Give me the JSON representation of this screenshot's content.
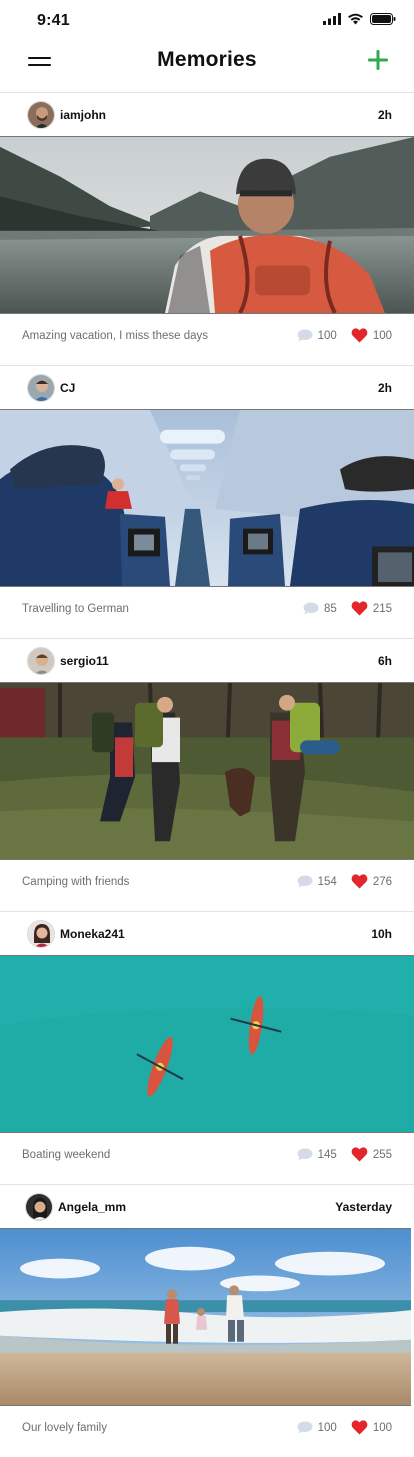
{
  "status_bar": {
    "time": "9:41",
    "icons": [
      "signal-icon",
      "wifi-icon",
      "battery-icon"
    ]
  },
  "header": {
    "title": "Memories",
    "menu_icon": "hamburger-icon",
    "add_icon": "plus-icon",
    "accent_color": "#2eaa4e"
  },
  "posts": [
    {
      "username": "iamjohn",
      "time": "2h",
      "caption": "Amazing vacation, I miss these days",
      "comments": "100",
      "likes": "100"
    },
    {
      "username": "CJ",
      "time": "2h",
      "caption": "Travelling to German",
      "comments": "85",
      "likes": "215"
    },
    {
      "username": "sergio11",
      "time": "6h",
      "caption": "Camping with friends",
      "comments": "154",
      "likes": "276"
    },
    {
      "username": "Moneka241",
      "time": "10h",
      "caption": "Boating weekend",
      "comments": "145",
      "likes": "255"
    },
    {
      "username": "Angela_mm",
      "time": "Yasterday",
      "caption": "Our lovely family",
      "comments": "100",
      "likes": "100"
    }
  ],
  "icons": {
    "comment": "comment-bubble-icon",
    "like": "heart-icon"
  },
  "colors": {
    "heart": "#e3262b",
    "comment": "#d4dbe6"
  }
}
